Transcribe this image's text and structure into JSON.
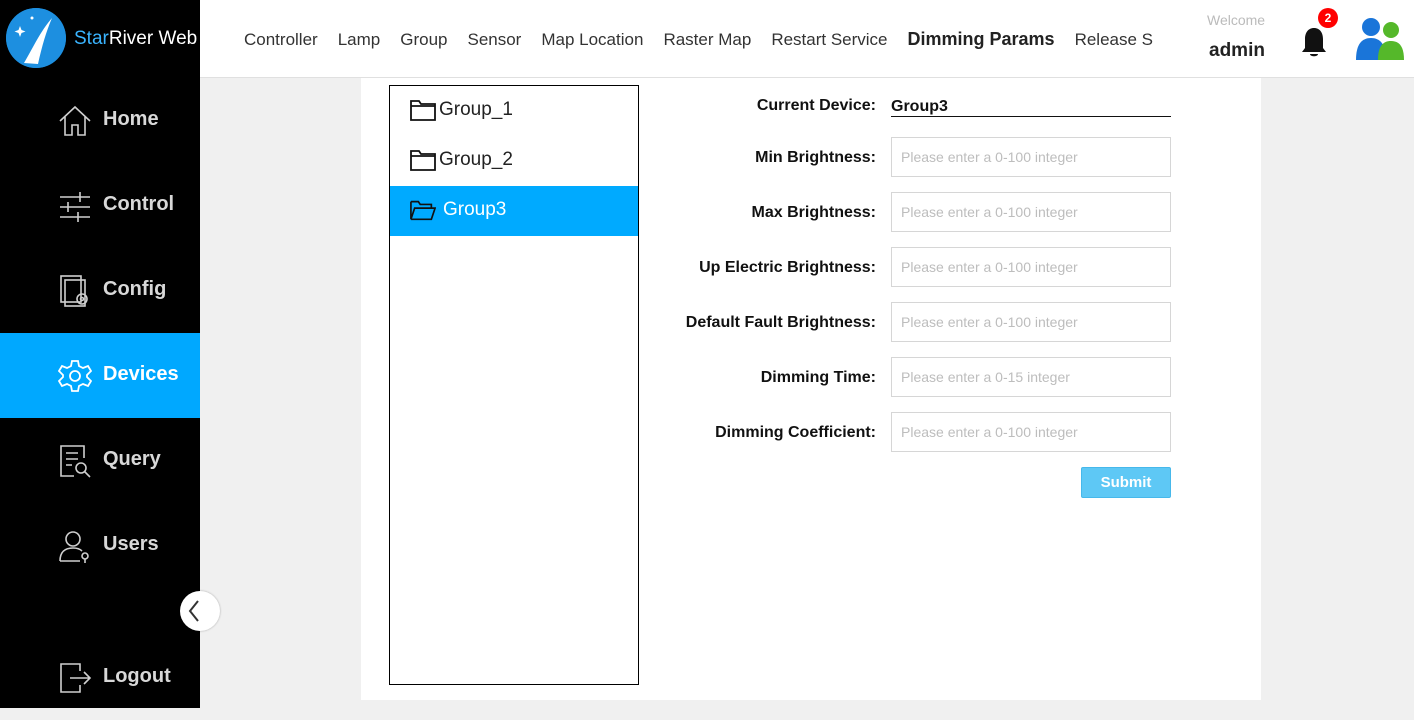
{
  "app": {
    "name_part1": "Star",
    "name_part2": "River Web"
  },
  "sidebar": {
    "items": [
      {
        "label": "Home",
        "icon": "home-icon"
      },
      {
        "label": "Control",
        "icon": "sliders-icon"
      },
      {
        "label": "Config",
        "icon": "config-icon"
      },
      {
        "label": "Devices",
        "icon": "gear-icon"
      },
      {
        "label": "Query",
        "icon": "query-icon"
      },
      {
        "label": "Users",
        "icon": "user-icon"
      },
      {
        "label": "Logout",
        "icon": "logout-icon"
      }
    ],
    "active": "Devices"
  },
  "topbar": {
    "tabs": [
      "Controller",
      "Lamp",
      "Group",
      "Sensor",
      "Map Location",
      "Raster Map",
      "Restart Service",
      "Dimming Params",
      "Release S"
    ],
    "active_tab": "Dimming Params",
    "welcome": "Welcome",
    "username": "admin",
    "notification_count": "2"
  },
  "tree": {
    "items": [
      "Group_1",
      "Group_2",
      "Group3"
    ],
    "selected": "Group3"
  },
  "form": {
    "current_device_label": "Current Device:",
    "current_device_value": "Group3",
    "fields": [
      {
        "label": "Min Brightness:",
        "placeholder": "Please enter a 0-100 integer"
      },
      {
        "label": "Max Brightness:",
        "placeholder": "Please enter a 0-100 integer"
      },
      {
        "label": "Up Electric Brightness:",
        "placeholder": "Please enter a 0-100 integer"
      },
      {
        "label": "Default Fault Brightness:",
        "placeholder": "Please enter a 0-100 integer"
      },
      {
        "label": "Dimming Time:",
        "placeholder": "Please enter a 0-15 integer"
      },
      {
        "label": "Dimming Coefficient:",
        "placeholder": "Please enter a 0-100 integer"
      }
    ],
    "submit_label": "Submit"
  },
  "colors": {
    "accent": "#00aaff",
    "sidebar_bg": "#000000",
    "badge": "#ff0000"
  }
}
